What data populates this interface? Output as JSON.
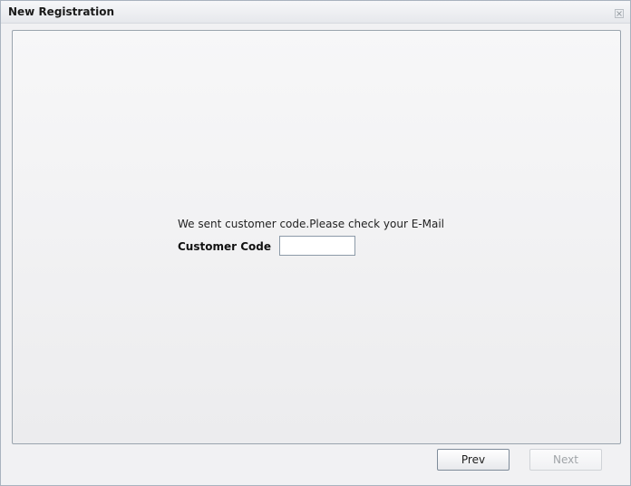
{
  "window": {
    "title": "New Registration",
    "close_icon": "close-icon"
  },
  "form": {
    "message": "We sent customer code.Please check your E-Mail",
    "customer_code_label": "Customer Code",
    "customer_code_value": "",
    "customer_code_placeholder": ""
  },
  "buttons": {
    "prev_label": "Prev",
    "next_label": "Next",
    "next_disabled": true
  },
  "colors": {
    "panel_border": "#9aa4ae",
    "disabled_text": "#a0a4a8"
  }
}
